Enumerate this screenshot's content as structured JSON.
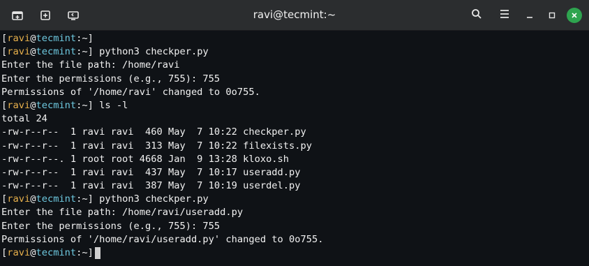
{
  "window": {
    "title": "ravi@tecmint:~",
    "icons": [
      "new-tab-icon",
      "split-icon",
      "history-icon",
      "search-icon",
      "menu-icon",
      "minimize-icon",
      "maximize-icon",
      "close-icon"
    ]
  },
  "prompt": {
    "open": "[",
    "user": "ravi",
    "at": "@",
    "host": "tecmint",
    "colon": ":",
    "path": "~",
    "close": "]"
  },
  "commands": {
    "c1": "python3 checkper.py",
    "c2": "ls -l",
    "c3": "python3 checkper.py"
  },
  "output": {
    "o1": "Enter the file path: /home/ravi",
    "o2": "Enter the permissions (e.g., 755): 755",
    "o3": "Permissions of '/home/ravi' changed to 0o755.",
    "o4": "total 24",
    "o5": "-rw-r--r--  1 ravi ravi  460 May  7 10:22 checkper.py",
    "o6": "-rw-r--r--  1 ravi ravi  313 May  7 10:22 filexists.py",
    "o7": "-rw-r--r--. 1 root root 4668 Jan  9 13:28 kloxo.sh",
    "o8": "-rw-r--r--  1 ravi ravi  437 May  7 10:17 useradd.py",
    "o9": "-rw-r--r--  1 ravi ravi  387 May  7 10:19 userdel.py",
    "o10": "Enter the file path: /home/ravi/useradd.py",
    "o11": "Enter the permissions (e.g., 755): 755",
    "o12": "Permissions of '/home/ravi/useradd.py' changed to 0o755."
  },
  "colors": {
    "background": "#0f1216",
    "titlebar": "#2b2d2f",
    "prompt_user": "#e7b04c",
    "prompt_host": "#6ec9e0",
    "close_button": "#2ea44f"
  }
}
